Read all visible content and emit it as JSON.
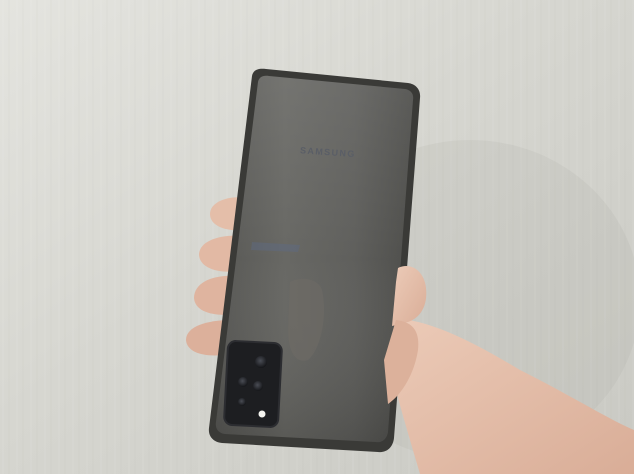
{
  "photo": {
    "subject": "hand-holding-phone",
    "phone_brand_text": "SAMSUNG",
    "colors": {
      "wall": "#dcdcd6",
      "phone_body": "#5b5b58",
      "phone_frame": "#3c3c3a",
      "camera_module": "#1e1f22",
      "skin": "#e7c3ae"
    }
  }
}
